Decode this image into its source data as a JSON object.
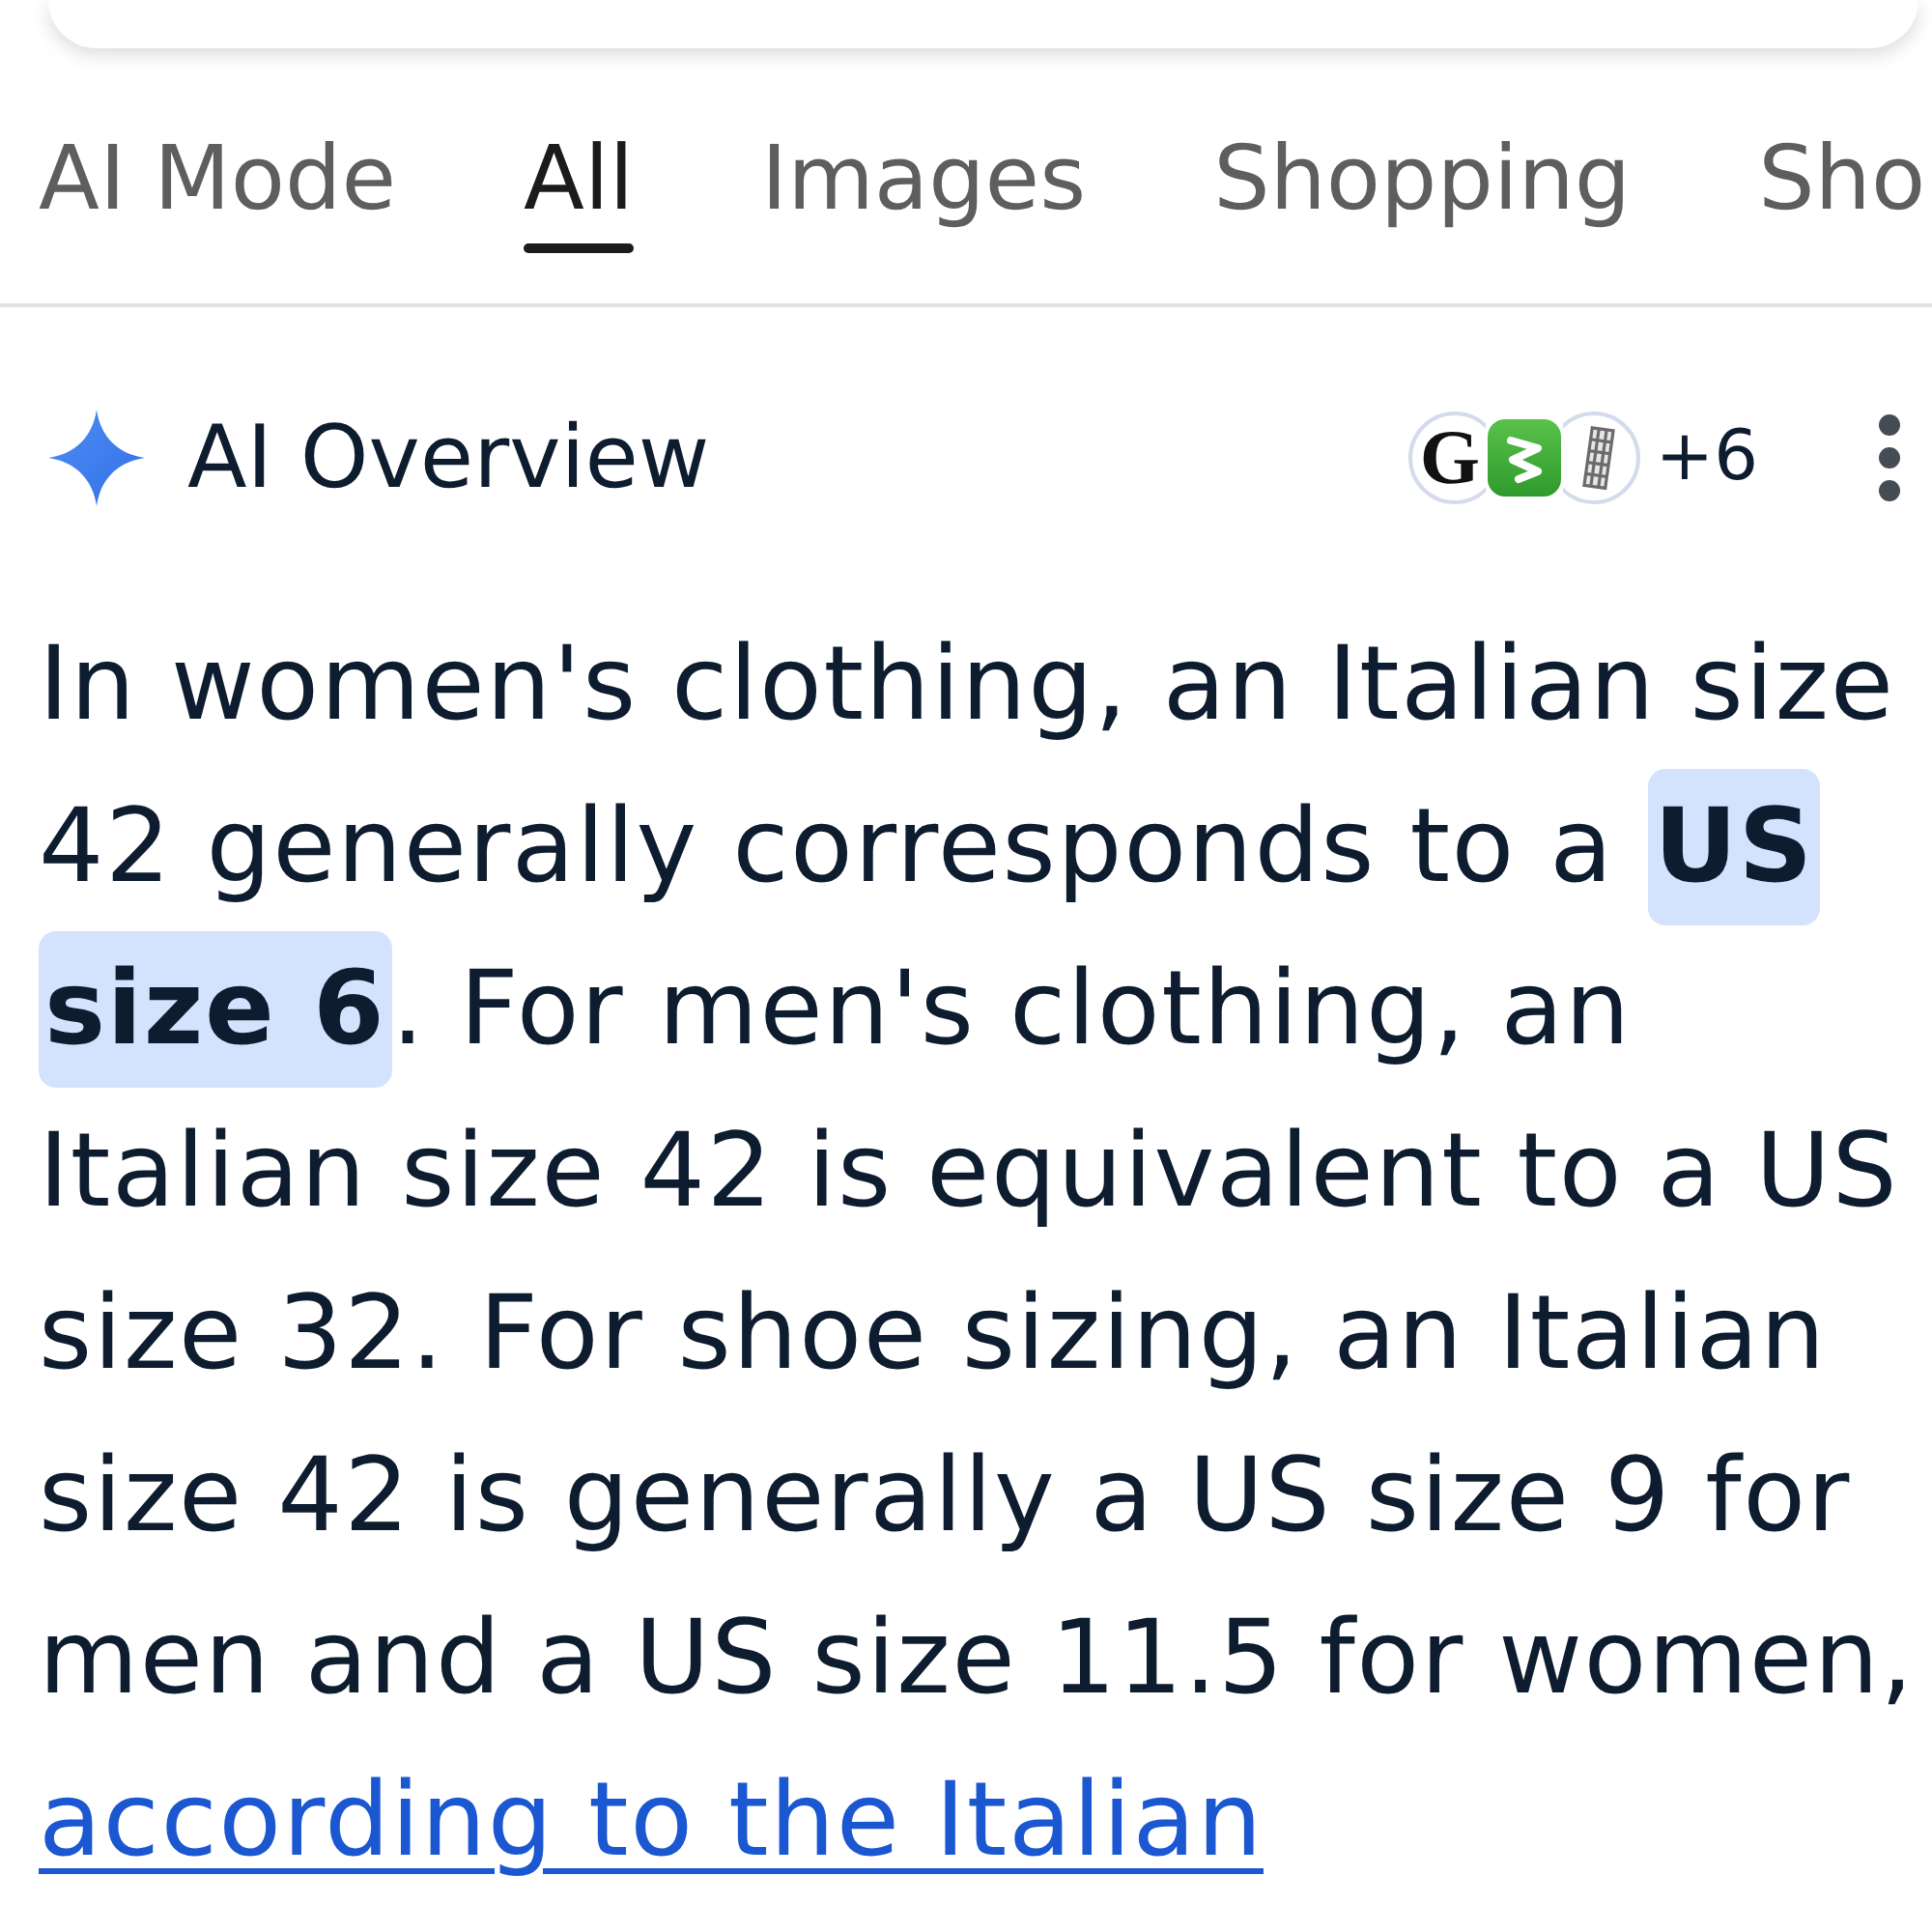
{
  "tabs": [
    {
      "label": "AI Mode",
      "selected": false
    },
    {
      "label": "All",
      "selected": true
    },
    {
      "label": "Images",
      "selected": false
    },
    {
      "label": "Shopping",
      "selected": false
    },
    {
      "label": "Sho",
      "selected": false
    }
  ],
  "ai_overview": {
    "title": "AI Overview",
    "sources": [
      {
        "kind": "letter",
        "text": "G"
      },
      {
        "kind": "tile"
      },
      {
        "kind": "tower"
      }
    ],
    "more_sources": "+6",
    "paragraph": {
      "text": "In women's clothing, an Italian size 42 generally corresponds to a **US size 6**. For men's clothing, an Italian size 42 is equivalent to a US size 32. For shoe sizing, an Italian size 42 is generally a US size 9 for men and a US size 11.5 for women,",
      "link": "according to the Italian"
    }
  }
}
